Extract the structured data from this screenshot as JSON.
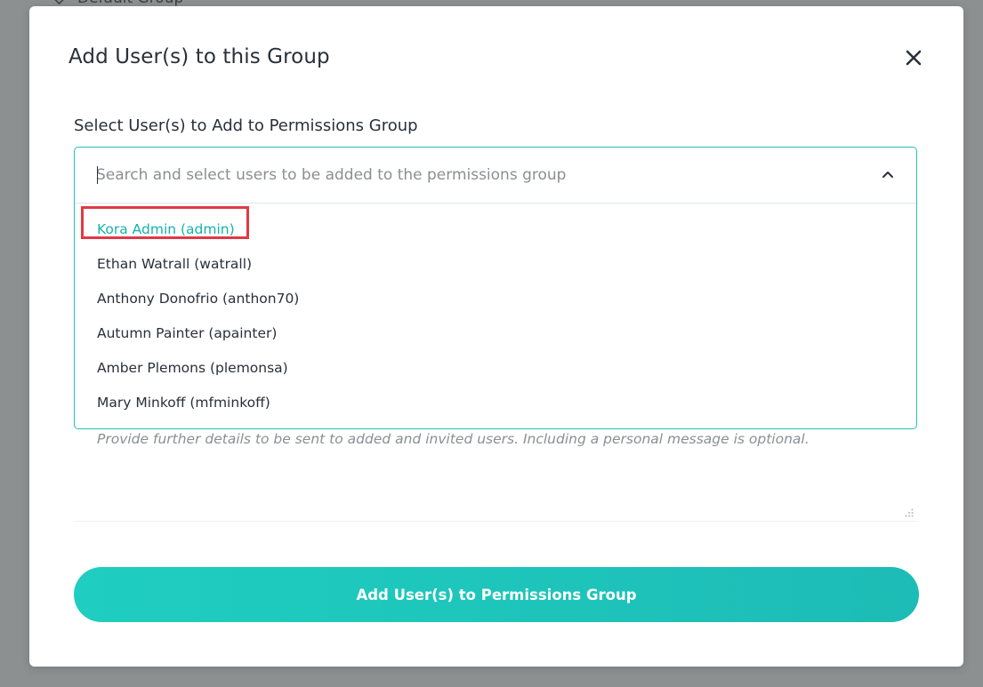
{
  "backdrop": {
    "group_name": "Default Group"
  },
  "modal": {
    "title": "Add User(s) to this Group",
    "close_icon": "close-icon"
  },
  "user_select": {
    "label": "Select User(s) to Add to Permissions Group",
    "placeholder": "Search and select users to be added to the permissions group",
    "value": "",
    "expanded": true,
    "options": [
      {
        "label": "Kora Admin (admin)",
        "highlighted": true
      },
      {
        "label": "Ethan Watrall (watrall)",
        "highlighted": false
      },
      {
        "label": "Anthony Donofrio (anthon70)",
        "highlighted": false
      },
      {
        "label": "Autumn Painter (apainter)",
        "highlighted": false
      },
      {
        "label": "Amber Plemons (plemonsa)",
        "highlighted": false
      },
      {
        "label": "Mary Minkoff (mfminkoff)",
        "highlighted": false
      }
    ]
  },
  "message": {
    "placeholder": "Provide further details to be sent to added and invited users. Including a personal message is optional.",
    "value": ""
  },
  "submit": {
    "label": "Add User(s) to Permissions Group"
  },
  "colors": {
    "accent": "#1ec4b9",
    "highlight_text": "#16b3aa",
    "annotation_box": "#e03a45",
    "backdrop": "#8c9091"
  }
}
